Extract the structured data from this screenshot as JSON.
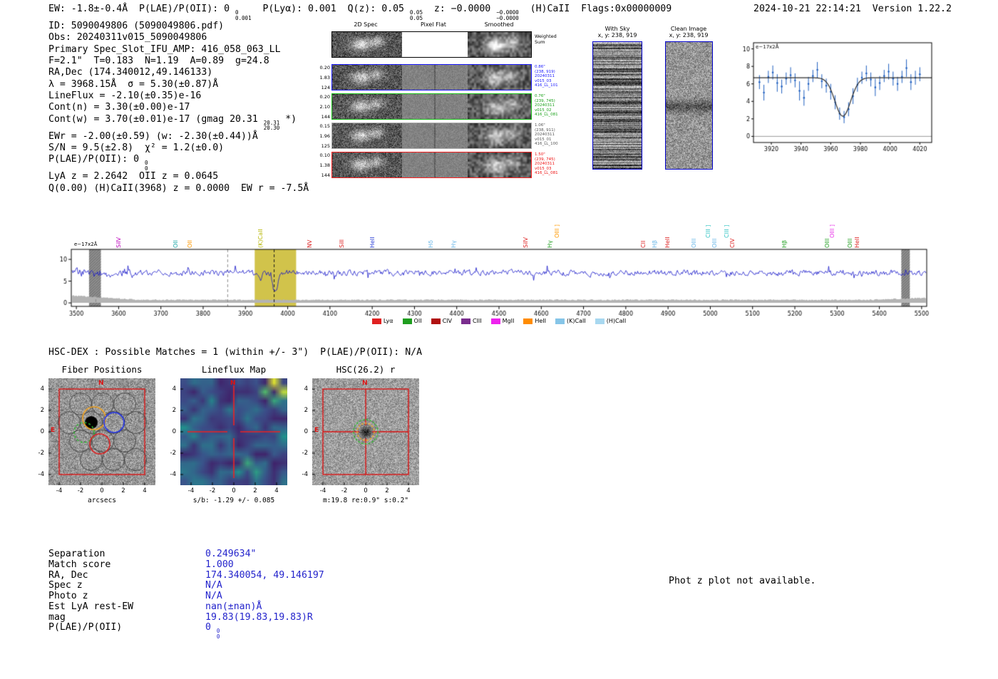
{
  "meta": {
    "datetime": "2024-10-21 22:14:21",
    "version": "Version 1.22.2"
  },
  "header_segments": [
    {
      "t": "EW: -1.8±-0.4Å  P(LAE)/P(OII): 0 "
    },
    {
      "sup": "0",
      "sub": "0.001"
    },
    {
      "t": "  P(Lyα): 0.001  Q(z): 0.05 "
    },
    {
      "sup": "0.05",
      "sub": "0.05"
    },
    {
      "t": "  z: −0.0000 "
    },
    {
      "sup": "−0.0000",
      "sub": "−0.0000"
    },
    {
      "t": "  (H)CaII  Flags:0x00000009"
    }
  ],
  "info_lines": [
    [
      {
        "t": "ID: 5090049806 (5090049806.pdf)"
      }
    ],
    [
      {
        "t": "Obs: 20240311v015_5090049806"
      }
    ],
    [
      {
        "t": "Primary Spec_Slot_IFU_AMP: 416_058_063_LL"
      }
    ],
    [
      {
        "t": "F=2.1\"  T=0.183  N=1.19  A=0.89  g=24.8"
      }
    ],
    [
      {
        "t": "RA,Dec (174.340012,49.146133)"
      }
    ],
    [
      {
        "t": "λ = 3968.15Å  σ = 5.30(±0.87)Å"
      }
    ],
    [
      {
        "t": "LineFlux = -2.10(±0.35)e-16"
      }
    ],
    [
      {
        "t": "Cont(n) = 3.30(±0.00)e-17"
      }
    ],
    [
      {
        "t": "Cont(w) = 3.70(±0.01)e-17 (gmag 20.31 "
      },
      {
        "sup": "20.31",
        "sub": "20.30"
      },
      {
        "t": " *)"
      }
    ],
    [
      {
        "t": "EWr = -2.00(±0.59) (w: -2.30(±0.44))Å"
      }
    ],
    [
      {
        "t": "S/N = 9.5(±2.8)  χ² = 1.2(±0.0)"
      }
    ],
    [
      {
        "t": "P(LAE)/P(OII): 0 "
      },
      {
        "sup": "0",
        "sub": "0"
      }
    ],
    [
      {
        "t": "LyA z = 2.2642  OII z = 0.0645"
      }
    ],
    [
      {
        "t": "Q(0.00) (H)CaII(3968) z = 0.0000  EW r = -7.5Å"
      }
    ]
  ],
  "cutouts": {
    "column_titles": [
      "2D Spec",
      "Pixel Flat",
      "Smoothed"
    ],
    "weighted_sum_label": "Weighted Sum",
    "rows": [
      {
        "border": "#1818ff",
        "text_color": "#1818ff",
        "left": [
          "0.20",
          "1.83",
          "124"
        ],
        "ann": [
          "0.86\"",
          "(238, 919)",
          "20240311",
          "v015_03",
          "416_LL_101"
        ]
      },
      {
        "border": "#18c018",
        "text_color": "#18a018",
        "left": [
          "0.20",
          "2.10",
          "144"
        ],
        "ann": [
          "0.76\"",
          "(239, 745)",
          "20240311",
          "v015_02",
          "416_LL_081"
        ]
      },
      {
        "border": "#aaaaaa",
        "text_color": "#555555",
        "left": [
          "0.15",
          "1.96",
          "125"
        ],
        "ann": [
          "1.06\"",
          "(238, 911)",
          "20240311",
          "v015_01",
          "416_LL_100"
        ]
      },
      {
        "border": "#ff2020",
        "text_color": "#ee1010",
        "left": [
          "0.10",
          "1.38",
          "144"
        ],
        "ann": [
          "1.50\"",
          "(239, 745)",
          "20240311",
          "v015_03",
          "416_LL_081"
        ]
      }
    ]
  },
  "stamps": {
    "with_sky": {
      "title": "With Sky",
      "coords": "x, y: 238, 919"
    },
    "clean": {
      "title": "Clean Image",
      "coords": "x, y: 238, 919"
    }
  },
  "chart_data": [
    {
      "id": "line_fit_plot",
      "type": "scatter",
      "ylabel": "e−17x2Å",
      "xlim": [
        3908,
        4028
      ],
      "ylim": [
        -0.7,
        10.7
      ],
      "xticks": [
        3920,
        3940,
        3960,
        3980,
        4000,
        4020
      ],
      "yticks": [
        0,
        2,
        4,
        6,
        8,
        10
      ],
      "series": [
        {
          "name": "observed spectrum",
          "color": "#2060c0",
          "x": [
            3912,
            3915,
            3918,
            3921,
            3924,
            3927,
            3930,
            3933,
            3936,
            3939,
            3942,
            3945,
            3948,
            3951,
            3954,
            3957,
            3960,
            3963,
            3966,
            3969,
            3972,
            3975,
            3978,
            3981,
            3984,
            3987,
            3990,
            3993,
            3996,
            3999,
            4002,
            4005,
            4008,
            4011,
            4014,
            4017,
            4020
          ],
          "y": [
            6.2,
            5.0,
            6.8,
            7.3,
            6.1,
            5.7,
            6.6,
            7.0,
            6.4,
            5.2,
            4.4,
            6.0,
            6.9,
            7.6,
            6.3,
            5.8,
            5.1,
            3.9,
            2.6,
            2.2,
            3.1,
            4.6,
            5.9,
            6.7,
            7.2,
            6.5,
            5.6,
            6.1,
            6.9,
            7.4,
            6.6,
            6.0,
            6.8,
            7.8,
            6.2,
            6.7,
            7.1
          ],
          "yerr": [
            0.8,
            0.9,
            0.7,
            0.8,
            1.0,
            0.8,
            0.7,
            0.9,
            0.8,
            1.1,
            0.9,
            0.8,
            0.7,
            0.9,
            0.8,
            0.8,
            0.9,
            0.8,
            0.7,
            0.7,
            0.8,
            0.9,
            0.8,
            0.7,
            0.9,
            0.8,
            1.0,
            0.8,
            0.7,
            0.9,
            0.8,
            0.8,
            0.7,
            1.0,
            0.9,
            0.8,
            0.8
          ]
        }
      ],
      "fit": {
        "name": "gaussian absorption fit",
        "color": "#2b2b2b",
        "continuum": 6.7,
        "center": 3968.15,
        "sigma": 5.3,
        "depth": 4.4
      }
    },
    {
      "id": "full_spectrum",
      "type": "line",
      "ylabel": "e−17x2Å",
      "xlim": [
        3488,
        5512
      ],
      "ylim": [
        -0.8,
        12.3
      ],
      "xticks": [
        3500,
        3600,
        3700,
        3800,
        3900,
        4000,
        4100,
        4200,
        4300,
        4400,
        4500,
        4600,
        4700,
        4800,
        4900,
        5000,
        5100,
        5200,
        5300,
        5400,
        5500
      ],
      "yticks": [
        0,
        5,
        10
      ],
      "series_color": "#1414c8",
      "continuum": 6.9,
      "absorption_features": [
        {
          "center": 3968,
          "sigma": 6,
          "depth": 4.8
        },
        {
          "center": 3934,
          "sigma": 4,
          "depth": 1.9
        }
      ],
      "noise": {
        "seed": 31,
        "amp": 1.0,
        "spike_prob": 0.06,
        "spike_amp": 2.4,
        "blue_end": 3780,
        "blue_extra": 1.1
      },
      "highlight_band": {
        "range": [
          3922,
          4020
        ],
        "color": "#c9b92c"
      },
      "grey_bands": [
        [
          3530,
          3558
        ],
        [
          5452,
          5472
        ]
      ],
      "dashed_lines": [
        {
          "x": 3546,
          "color": "#8a8a8a"
        },
        {
          "x": 3858,
          "color": "#8a8a8a"
        },
        {
          "x": 3968,
          "color": "#1a1a1a"
        }
      ],
      "error_band": {
        "level": 0.7,
        "color": "#b3b3b3"
      },
      "line_labels": [
        {
          "text": "SiIV",
          "wl": 3600,
          "color": "#bb00bb",
          "tier": 1
        },
        {
          "text": "OII",
          "wl": 3735,
          "color": "#1fa8a8",
          "tier": 1
        },
        {
          "text": "OII",
          "wl": 3768,
          "color": "#ff9900",
          "tier": 1
        },
        {
          "text": "(K)CaII",
          "wl": 3935,
          "color": "#b5b500",
          "tier": 1
        },
        {
          "text": "NV",
          "wl": 4052,
          "color": "#dd2222",
          "tier": 1
        },
        {
          "text": "SiII",
          "wl": 4128,
          "color": "#dd2222",
          "tier": 1
        },
        {
          "text": "HeII",
          "wl": 4200,
          "color": "#2b3fd6",
          "tier": 1
        },
        {
          "text": "Hδ",
          "wl": 4338,
          "color": "#6cb8e8",
          "tier": 1
        },
        {
          "text": "Hγ",
          "wl": 4392,
          "color": "#6cb8e8",
          "tier": 1
        },
        {
          "text": "SiIV",
          "wl": 4562,
          "color": "#dd2222",
          "tier": 1
        },
        {
          "text": "Hγ",
          "wl": 4620,
          "color": "#28a228",
          "tier": 1
        },
        {
          "text": "OIII ]",
          "wl": 4636,
          "color": "#ff9900",
          "tier": 2
        },
        {
          "text": "CII",
          "wl": 4840,
          "color": "#dd2222",
          "tier": 1
        },
        {
          "text": "Hβ",
          "wl": 4868,
          "color": "#6cb8e8",
          "tier": 1
        },
        {
          "text": "HeII",
          "wl": 4898,
          "color": "#dd2222",
          "tier": 1
        },
        {
          "text": "OIII",
          "wl": 4960,
          "color": "#6cb8e8",
          "tier": 1
        },
        {
          "text": "CIII ]",
          "wl": 4994,
          "color": "#2fc3c3",
          "tier": 2
        },
        {
          "text": "OIII",
          "wl": 5010,
          "color": "#6cb8e8",
          "tier": 1
        },
        {
          "text": "CIII ]",
          "wl": 5038,
          "color": "#2fc3c3",
          "tier": 2
        },
        {
          "text": "CIV",
          "wl": 5052,
          "color": "#dd2222",
          "tier": 1
        },
        {
          "text": "Hβ",
          "wl": 5175,
          "color": "#28a228",
          "tier": 1
        },
        {
          "text": "OIII",
          "wl": 5276,
          "color": "#28a228",
          "tier": 1
        },
        {
          "text": "OIII ]",
          "wl": 5288,
          "color": "#e832e8",
          "tier": 2
        },
        {
          "text": "OIII",
          "wl": 5330,
          "color": "#28a228",
          "tier": 1
        },
        {
          "text": "HeII",
          "wl": 5346,
          "color": "#dd2222",
          "tier": 1
        }
      ],
      "legend": [
        {
          "label": "Lyα",
          "color": "#e02020"
        },
        {
          "label": "OII",
          "color": "#1f9e1f"
        },
        {
          "label": "CIV",
          "color": "#b01010"
        },
        {
          "label": "CIII",
          "color": "#7a2d8e"
        },
        {
          "label": "MgII",
          "color": "#ee22ee"
        },
        {
          "label": "HeII",
          "color": "#ff8c00"
        },
        {
          "label": "(K)CaII",
          "color": "#86c5e8"
        },
        {
          "label": "(H)CaII",
          "color": "#a8d8f0"
        }
      ]
    }
  ],
  "hsc_header": "HSC-DEX : Possible Matches = 1 (within +/- 3\")  P(LAE)/P(OII): N/A",
  "panels": [
    {
      "id": "fiber_positions",
      "title": "Fiber Positions",
      "xlabel": "arcsecs",
      "xticks": [
        -4,
        -2,
        0,
        2,
        4
      ],
      "yticks": [
        4,
        2,
        0,
        -2,
        -4
      ],
      "compass_n": "N",
      "compass_e": "E",
      "kind": "fibers"
    },
    {
      "id": "lineflux_map",
      "title": "Lineflux Map",
      "xlabel": "s/b: -1.29 +/- 0.085",
      "xticks": [
        -4,
        -2,
        0,
        2,
        4
      ],
      "yticks": [
        4,
        2,
        0,
        -2,
        -4
      ],
      "compass_n": "N",
      "compass_e": "",
      "kind": "lineflux"
    },
    {
      "id": "hsc_r",
      "title": "HSC(26.2) r",
      "xlabel": "m:19.8 re:0.9\" s:0.2\"",
      "xticks": [
        -4,
        -2,
        0,
        2,
        4
      ],
      "yticks": [
        4,
        2,
        0,
        -2,
        -4
      ],
      "compass_n": "N",
      "compass_e": "E",
      "kind": "hsc"
    }
  ],
  "match_table": {
    "rows": [
      {
        "label": "Separation",
        "value": "0.249634\""
      },
      {
        "label": "Match score",
        "value": "1.000"
      },
      {
        "label": "RA, Dec",
        "value": "174.340054, 49.146197"
      },
      {
        "label": "Spec z",
        "value": "N/A"
      },
      {
        "label": "Photo z",
        "value": "N/A"
      },
      {
        "label": "Est LyA rest-EW",
        "value": "nan(±nan)Å"
      },
      {
        "label": "mag",
        "value": "19.83(19.83,19.83)R"
      },
      {
        "label": "P(LAE)/P(OII)",
        "value": "0",
        "sup": "0",
        "sub": "0"
      }
    ]
  },
  "photz_note": "Phot z plot not available."
}
